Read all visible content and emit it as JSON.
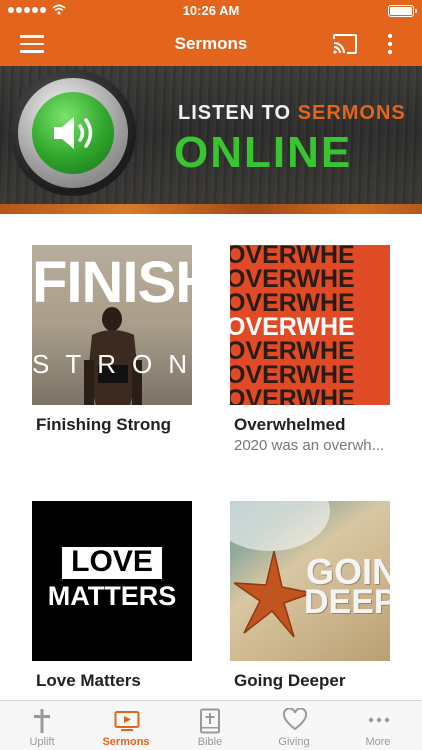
{
  "status_bar": {
    "time": "10:26 AM"
  },
  "header": {
    "title": "Sermons",
    "menu_icon": "hamburger-icon",
    "cast_icon": "cast-icon",
    "more_icon": "more-vertical-icon"
  },
  "banner": {
    "line1_a": "LISTEN TO ",
    "line1_b": "SERMONS",
    "line2": "ONLINE",
    "accent_color": "#e2641d",
    "green_color": "#38c530"
  },
  "series": [
    {
      "title": "Finishing Strong",
      "subtitle": "",
      "art_text_1": "FINISH",
      "art_text_2": "STRON"
    },
    {
      "title": "Overwhelmed",
      "subtitle": "2020 was an overwh...",
      "art_text": "OVERWHE"
    },
    {
      "title": "Love Matters",
      "subtitle": "",
      "art_text_1": "LOVE",
      "art_text_2": "MATTERS"
    },
    {
      "title": "Going Deeper",
      "subtitle": "",
      "art_text_1": "GOIN",
      "art_text_2": "DEEPE"
    }
  ],
  "tabs": [
    {
      "label": "Uplift",
      "icon": "cross-icon",
      "active": false
    },
    {
      "label": "Sermons",
      "icon": "tv-play-icon",
      "active": true
    },
    {
      "label": "Bible",
      "icon": "bible-icon",
      "active": false
    },
    {
      "label": "Giving",
      "icon": "heart-icon",
      "active": false
    },
    {
      "label": "More",
      "icon": "more-horizontal-icon",
      "active": false
    }
  ],
  "colors": {
    "brand": "#e2641d",
    "tab_inactive": "#999999"
  }
}
